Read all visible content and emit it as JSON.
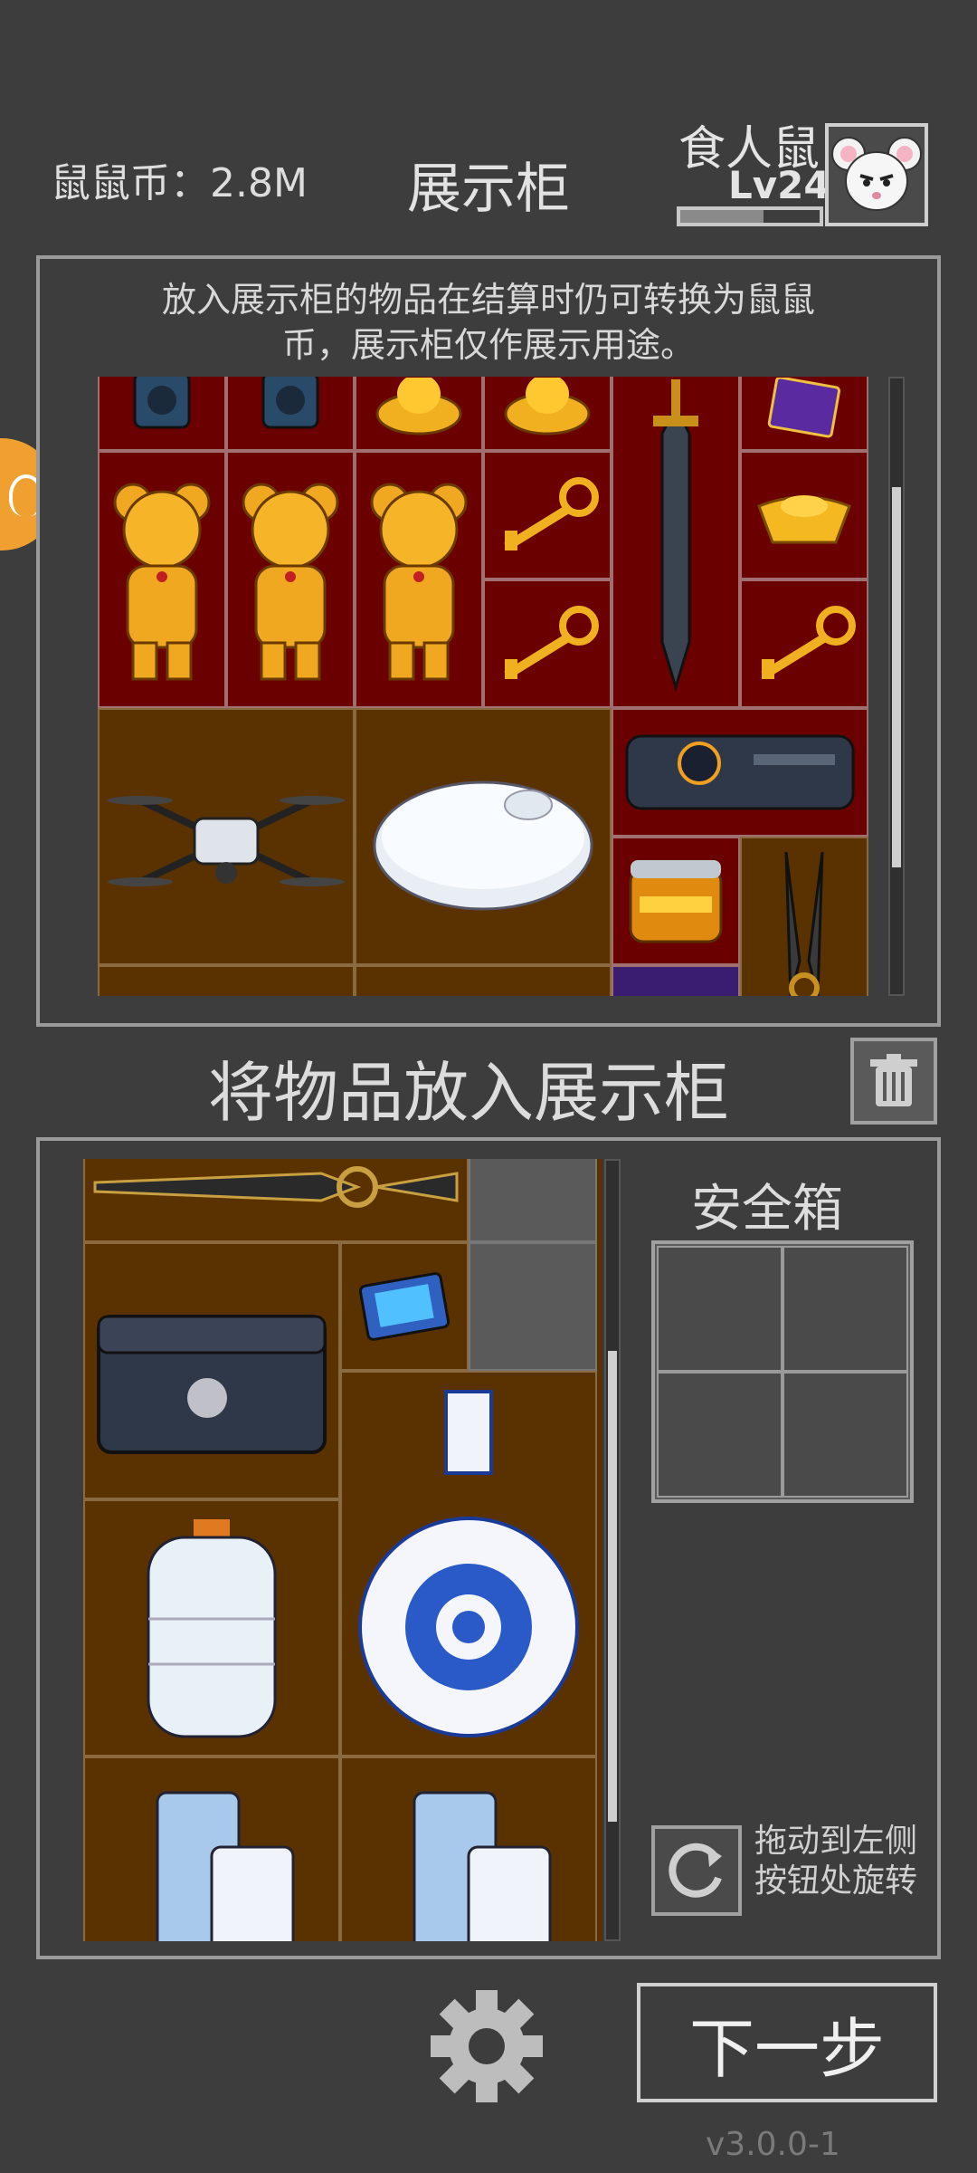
{
  "header": {
    "coins_text": "鼠鼠币：2.8M",
    "title": "展示柜",
    "player_name": "食人鼠",
    "player_level": "Lv24",
    "xp_fraction": 0.6
  },
  "display_case": {
    "notice": "放入展示柜的物品在结算时仍可转换为鼠鼠币，展示柜仅作展示用途。",
    "items": [
      "speaker-icon",
      "speaker-icon",
      "golden-bell-icon",
      "golden-bell-icon",
      "sword-icon",
      "purple-card-icon",
      "golden-bear-icon",
      "golden-bear-icon",
      "golden-bear-icon",
      "gold-key-icon",
      "gold-key-icon",
      "gold-ingot-icon",
      "gold-key-icon",
      "drone-icon",
      "robot-vacuum-icon",
      "tech-device-icon",
      "golden-jar-icon",
      "claw-blade-icon"
    ]
  },
  "place_section": {
    "label": "将物品放入展示柜"
  },
  "inventory": {
    "items": [
      "ornate-sword-icon",
      "chip-icon",
      "bear-crate-icon",
      "blue-white-vase-icon",
      "nitrogen-tank-icon",
      "machine-icon",
      "machine-icon"
    ]
  },
  "safe": {
    "title": "安全箱"
  },
  "rotate_hint_line1": "拖动到左侧",
  "rotate_hint_line2": "按钮处旋转",
  "next_button": "下一步",
  "version": "v3.0.0-1",
  "colors": {
    "background": "#3d3d3d",
    "red_cell": "#6a0000",
    "brown_cell": "#5a3200",
    "accent_orange": "#f0a030"
  }
}
